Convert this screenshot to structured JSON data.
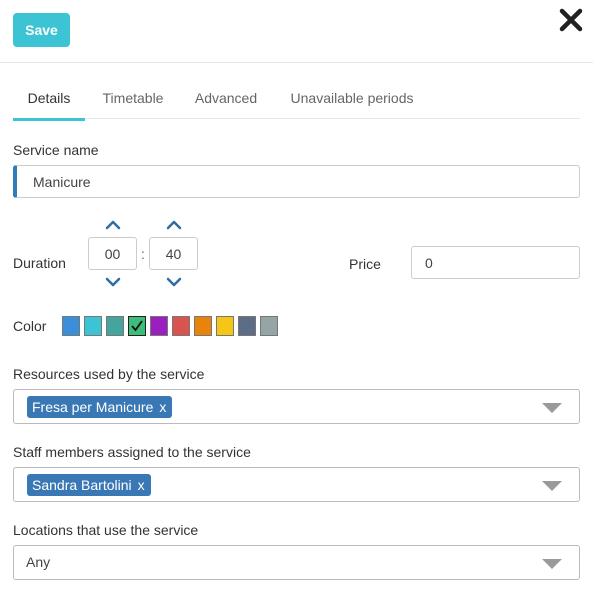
{
  "toolbar": {
    "save_label": "Save"
  },
  "tabs": [
    {
      "label": "Details",
      "active": true
    },
    {
      "label": "Timetable",
      "active": false
    },
    {
      "label": "Advanced",
      "active": false
    },
    {
      "label": "Unavailable periods",
      "active": false
    }
  ],
  "form": {
    "service_name_label": "Service name",
    "service_name_value": "Manicure",
    "duration_label": "Duration",
    "duration_hours": "00",
    "duration_separator": ":",
    "duration_minutes": "40",
    "price_label": "Price",
    "price_value": "0",
    "color_label": "Color",
    "colors": [
      "#3b8fd9",
      "#3cc4d4",
      "#45a59e",
      "#3dbd7a",
      "#9b1fbf",
      "#d9534f",
      "#e8840c",
      "#f5c518",
      "#5d6d85",
      "#95a5a6"
    ],
    "selected_color_index": 3,
    "resources_label": "Resources used by the service",
    "resources_tag": "Fresa per Manicure",
    "staff_label": "Staff members assigned to the service",
    "staff_tag": "Sandra Bartolini",
    "locations_label": "Locations that use the service",
    "locations_value": "Any",
    "tag_remove_glyph": "x"
  },
  "colors": {
    "accent": "#3cc4d4",
    "tag_bg": "#3a78b5",
    "chevron": "#2e6da4"
  }
}
